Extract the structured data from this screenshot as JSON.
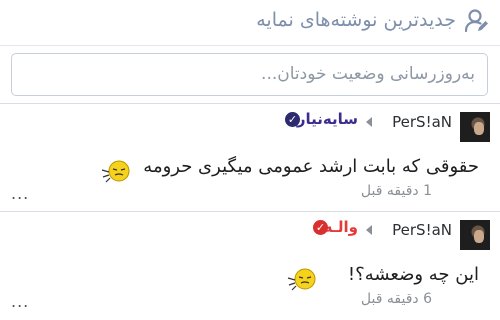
{
  "header": {
    "title": "جدیدترین نوشته‌های نمایه",
    "icon": "user-edit-icon"
  },
  "composer": {
    "placeholder": "به‌روزرسانی وضعیت خودتان..."
  },
  "posts": [
    {
      "author": "PerS!aN",
      "group": "سایه‌نیار",
      "group_color": "#3b2d8f",
      "badge_color": "#2d2a6e",
      "text": "حقوقی که بابت ارشد عمومی میگیری حرومه",
      "time": "1 دقیقه قبل",
      "more": "..."
    },
    {
      "author": "PerS!aN",
      "group": "والـه",
      "group_color": "#e33a3a",
      "badge_color": "#d92f2f",
      "text": "این چه وضعشه؟!",
      "time": "6 دقیقه قبل",
      "more": "..."
    }
  ]
}
